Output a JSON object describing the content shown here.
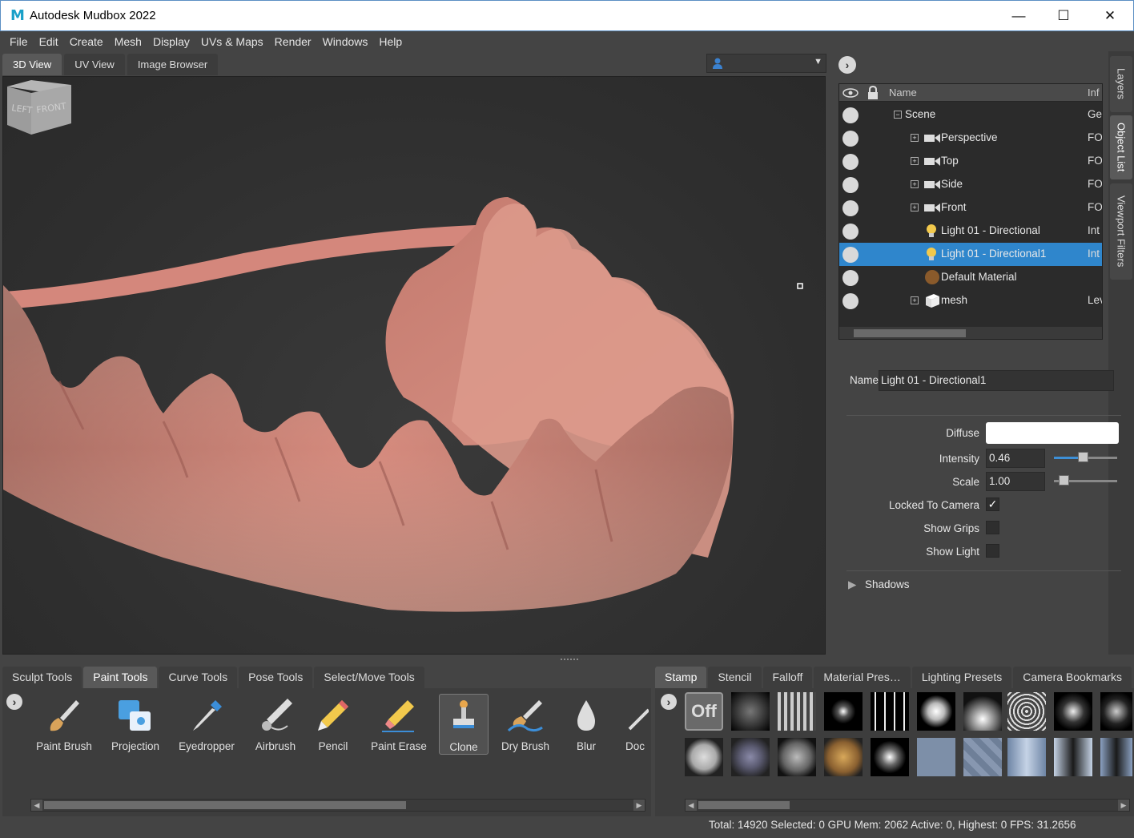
{
  "window": {
    "title": "Autodesk Mudbox 2022",
    "app_icon": "M",
    "minimize": "—",
    "maximize": "☐",
    "close": "✕"
  },
  "menu": [
    "File",
    "Edit",
    "Create",
    "Mesh",
    "Display",
    "UVs & Maps",
    "Render",
    "Windows",
    "Help"
  ],
  "view_tabs": [
    {
      "label": "3D View",
      "active": true
    },
    {
      "label": "UV View",
      "active": false
    },
    {
      "label": "Image Browser",
      "active": false
    }
  ],
  "viewcube": {
    "left": "LEFT",
    "front": "FRONT"
  },
  "right_panel": {
    "expand_icon": "›",
    "side_tabs": [
      "Layers",
      "Object List",
      "Viewport Filters"
    ],
    "outliner": {
      "columns": {
        "name": "Name",
        "info": "Inf"
      },
      "rows": [
        {
          "label": "Scene",
          "info": "Ge",
          "icon": "tree-minus"
        },
        {
          "label": "Perspective",
          "info": "FO",
          "icon": "camera"
        },
        {
          "label": "Top",
          "info": "FO",
          "icon": "camera"
        },
        {
          "label": "Side",
          "info": "FO",
          "icon": "camera"
        },
        {
          "label": "Front",
          "info": "FO",
          "icon": "camera"
        },
        {
          "label": "Light 01 - Directional",
          "info": "Int",
          "icon": "light-bulb"
        },
        {
          "label": "Light 01 - Directional1",
          "info": "Int",
          "icon": "light-bulb",
          "selected": true
        },
        {
          "label": "Default Material",
          "info": "",
          "icon": "material-sphere"
        },
        {
          "label": "mesh",
          "info": "Lev",
          "icon": "mesh-cube"
        }
      ]
    },
    "properties": {
      "name_label": "Name",
      "name_value": "Light 01 - Directional1",
      "diffuse_label": "Diffuse",
      "diffuse_color": "#ffffff",
      "intensity_label": "Intensity",
      "intensity_value": "0.46",
      "scale_label": "Scale",
      "scale_value": "1.00",
      "locked_label": "Locked To Camera",
      "locked_checked": "✓",
      "grips_label": "Show Grips",
      "showlight_label": "Show Light",
      "shadows_label": "Shadows",
      "shadows_arrow": "▶"
    }
  },
  "tool_tabs": [
    {
      "label": "Sculpt Tools",
      "active": false
    },
    {
      "label": "Paint Tools",
      "active": true
    },
    {
      "label": "Curve Tools",
      "active": false
    },
    {
      "label": "Pose Tools",
      "active": false
    },
    {
      "label": "Select/Move Tools",
      "active": false
    }
  ],
  "tools": [
    {
      "label": "Paint Brush",
      "icon": "paint-brush-icon"
    },
    {
      "label": "Projection",
      "icon": "projection-icon"
    },
    {
      "label": "Eyedropper",
      "icon": "eyedropper-icon"
    },
    {
      "label": "Airbrush",
      "icon": "airbrush-icon"
    },
    {
      "label": "Pencil",
      "icon": "pencil-icon"
    },
    {
      "label": "Paint Erase",
      "icon": "paint-erase-icon"
    },
    {
      "label": "Clone",
      "icon": "clone-icon",
      "active": true
    },
    {
      "label": "Dry Brush",
      "icon": "dry-brush-icon"
    },
    {
      "label": "Blur",
      "icon": "blur-icon"
    },
    {
      "label": "Doc",
      "icon": "dodge-icon"
    }
  ],
  "stamp_tabs": [
    {
      "label": "Stamp",
      "active": true
    },
    {
      "label": "Stencil",
      "active": false
    },
    {
      "label": "Falloff",
      "active": false
    },
    {
      "label": "Material Pres…",
      "active": false
    },
    {
      "label": "Lighting Presets",
      "active": false
    },
    {
      "label": "Camera Bookmarks",
      "active": false
    }
  ],
  "stamp_off": "Off",
  "status": "Total: 14920  Selected: 0 GPU Mem: 2062  Active: 0, Highest: 0  FPS: 31.2656"
}
